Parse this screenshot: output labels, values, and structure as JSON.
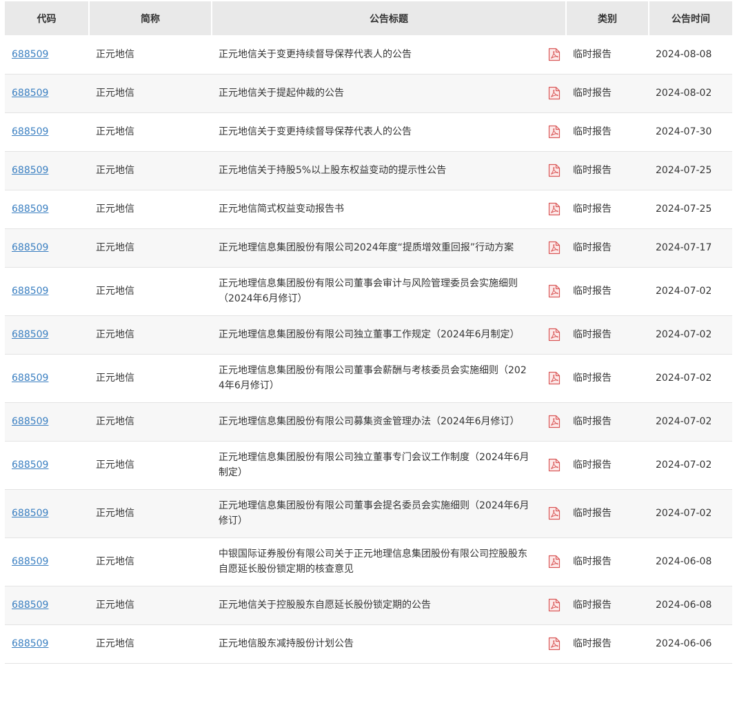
{
  "columns": {
    "code": "代码",
    "name": "简称",
    "title": "公告标题",
    "type": "类别",
    "date": "公告时间"
  },
  "icon": {
    "pdf": "pdf-file-icon",
    "color": "#d95757"
  },
  "colors": {
    "link": "#3a7fc1",
    "header_bg": "#e9e9e9",
    "stripe_bg": "#f7f7f7"
  },
  "rows": [
    {
      "code": "688509",
      "name": "正元地信",
      "title": "正元地信关于变更持续督导保荐代表人的公告",
      "type": "临时报告",
      "date": "2024-08-08"
    },
    {
      "code": "688509",
      "name": "正元地信",
      "title": "正元地信关于提起仲裁的公告",
      "type": "临时报告",
      "date": "2024-08-02"
    },
    {
      "code": "688509",
      "name": "正元地信",
      "title": "正元地信关于变更持续督导保荐代表人的公告",
      "type": "临时报告",
      "date": "2024-07-30"
    },
    {
      "code": "688509",
      "name": "正元地信",
      "title": "正元地信关于持股5%以上股东权益变动的提示性公告",
      "type": "临时报告",
      "date": "2024-07-25"
    },
    {
      "code": "688509",
      "name": "正元地信",
      "title": "正元地信简式权益变动报告书",
      "type": "临时报告",
      "date": "2024-07-25"
    },
    {
      "code": "688509",
      "name": "正元地信",
      "title": "正元地理信息集团股份有限公司2024年度“提质增效重回报”行动方案",
      "type": "临时报告",
      "date": "2024-07-17"
    },
    {
      "code": "688509",
      "name": "正元地信",
      "title": "正元地理信息集团股份有限公司董事会审计与风险管理委员会实施细则（2024年6月修订）",
      "type": "临时报告",
      "date": "2024-07-02"
    },
    {
      "code": "688509",
      "name": "正元地信",
      "title": "正元地理信息集团股份有限公司独立董事工作规定（2024年6月制定）",
      "type": "临时报告",
      "date": "2024-07-02"
    },
    {
      "code": "688509",
      "name": "正元地信",
      "title": "正元地理信息集团股份有限公司董事会薪酬与考核委员会实施细则（2024年6月修订）",
      "type": "临时报告",
      "date": "2024-07-02"
    },
    {
      "code": "688509",
      "name": "正元地信",
      "title": "正元地理信息集团股份有限公司募集资金管理办法（2024年6月修订）",
      "type": "临时报告",
      "date": "2024-07-02"
    },
    {
      "code": "688509",
      "name": "正元地信",
      "title": "正元地理信息集团股份有限公司独立董事专门会议工作制度（2024年6月制定）",
      "type": "临时报告",
      "date": "2024-07-02"
    },
    {
      "code": "688509",
      "name": "正元地信",
      "title": "正元地理信息集团股份有限公司董事会提名委员会实施细则（2024年6月修订）",
      "type": "临时报告",
      "date": "2024-07-02"
    },
    {
      "code": "688509",
      "name": "正元地信",
      "title": "中银国际证券股份有限公司关于正元地理信息集团股份有限公司控股股东自愿延长股份锁定期的核查意见",
      "type": "临时报告",
      "date": "2024-06-08"
    },
    {
      "code": "688509",
      "name": "正元地信",
      "title": "正元地信关于控股股东自愿延长股份锁定期的公告",
      "type": "临时报告",
      "date": "2024-06-08"
    },
    {
      "code": "688509",
      "name": "正元地信",
      "title": "正元地信股东减持股份计划公告",
      "type": "临时报告",
      "date": "2024-06-06"
    }
  ]
}
